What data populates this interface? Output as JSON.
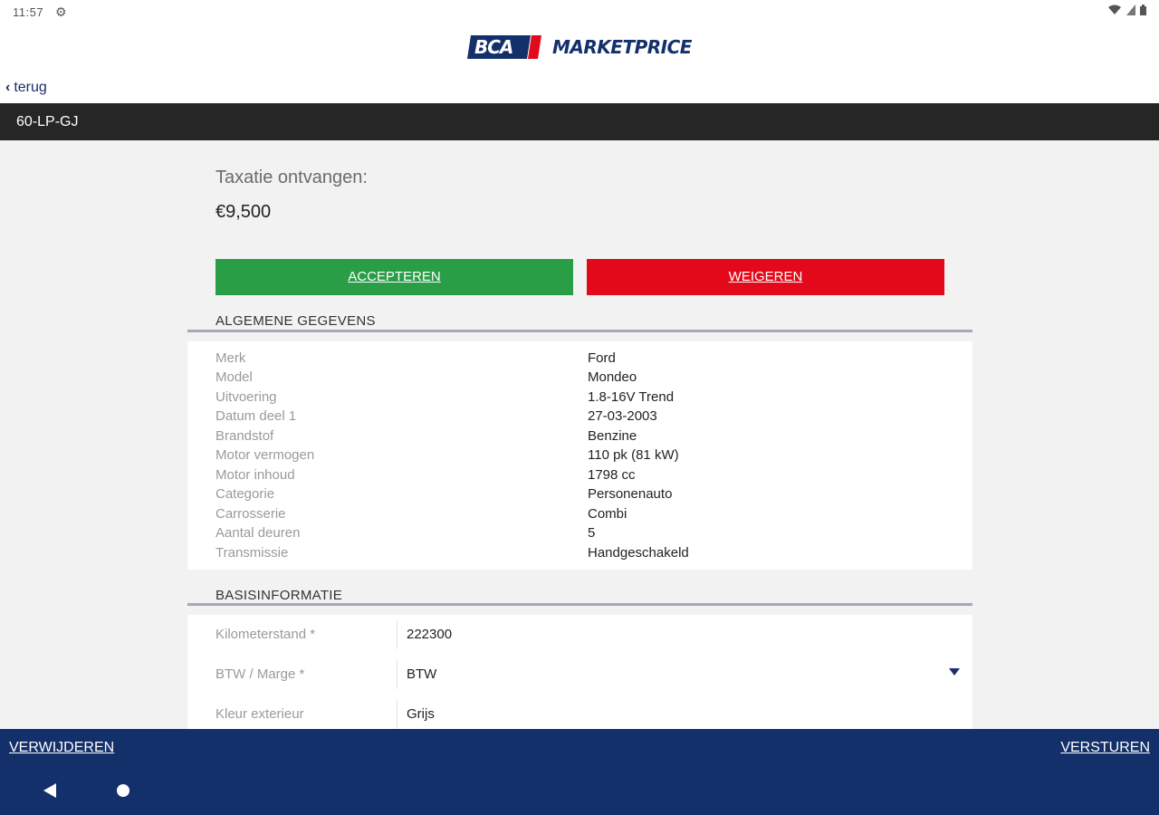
{
  "status_bar": {
    "time": "11:57",
    "settings_icon": "gear-icon",
    "right_icons": "wifi-icon signal-icon battery-icon"
  },
  "header": {
    "logo_badge": "BCA",
    "logo_text": "MARKETPRICE",
    "back_label": "terug"
  },
  "plate": "60-LP-GJ",
  "valuation": {
    "label": "Taxatie ontvangen:",
    "value": "€9,500"
  },
  "actions": {
    "accept": "ACCEPTEREN",
    "reject": "WEIGEREN"
  },
  "general": {
    "title": "ALGEMENE GEGEVENS",
    "rows": [
      {
        "label": "Merk",
        "value": "Ford"
      },
      {
        "label": "Model",
        "value": "Mondeo"
      },
      {
        "label": "Uitvoering",
        "value": "1.8-16V Trend"
      },
      {
        "label": "Datum deel 1",
        "value": "27-03-2003"
      },
      {
        "label": "Brandstof",
        "value": "Benzine"
      },
      {
        "label": "Motor vermogen",
        "value": "110 pk (81 kW)"
      },
      {
        "label": "Motor inhoud",
        "value": "1798 cc"
      },
      {
        "label": "Categorie",
        "value": "Personenauto"
      },
      {
        "label": "Carrosserie",
        "value": "Combi"
      },
      {
        "label": "Aantal deuren",
        "value": "5"
      },
      {
        "label": "Transmissie",
        "value": "Handgeschakeld"
      }
    ]
  },
  "basic": {
    "title": "BASISINFORMATIE",
    "fields": [
      {
        "label": "Kilometerstand *",
        "value": "222300"
      },
      {
        "label": "BTW / Marge *",
        "value": "BTW"
      },
      {
        "label": "Kleur exterieur",
        "value": "Grijs"
      }
    ]
  },
  "bottom": {
    "delete": "VERWIJDEREN",
    "send": "VERSTUREN"
  },
  "colors": {
    "brand_navy": "#13306b",
    "accept_green": "#2a9d47",
    "reject_red": "#e3091a"
  }
}
